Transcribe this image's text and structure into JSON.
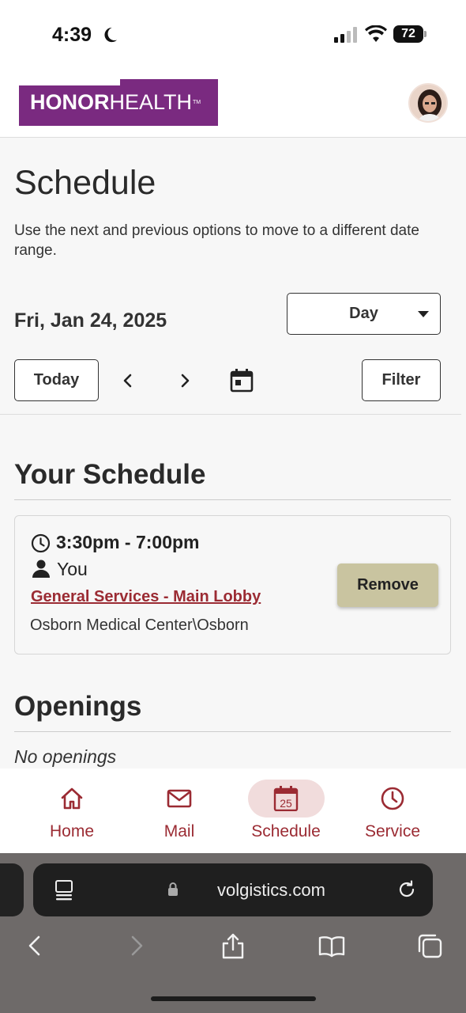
{
  "status_bar": {
    "time": "4:39",
    "battery": "72"
  },
  "header": {
    "logo_bold": "HONOR",
    "logo_light": "HEALTH",
    "logo_tm": "TM"
  },
  "page": {
    "title": "Schedule",
    "subtitle": "Use the next and previous options to move to a different date range.",
    "date_label": "Fri, Jan 24, 2025",
    "view_select": "Day",
    "today_label": "Today",
    "filter_label": "Filter"
  },
  "your_schedule": {
    "title": "Your Schedule",
    "shift": {
      "time": "3:30pm - 7:00pm",
      "who": "You",
      "assignment": "General Services - Main Lobby",
      "location": "Osborn Medical Center\\Osborn",
      "remove_label": "Remove"
    }
  },
  "openings": {
    "title": "Openings",
    "empty_text": "No openings"
  },
  "app_nav": {
    "items": [
      {
        "label": "Home",
        "icon": "home-icon"
      },
      {
        "label": "Mail",
        "icon": "mail-icon"
      },
      {
        "label": "Schedule",
        "icon": "calendar-icon",
        "day": "25",
        "active": true
      },
      {
        "label": "Service",
        "icon": "clock-icon"
      }
    ]
  },
  "browser": {
    "url": "volgistics.com"
  },
  "colors": {
    "brand_purple": "#7a2a80",
    "accent_red": "#9b2b33",
    "remove_button": "#c9c4a0",
    "active_pill": "#f1dcdc"
  }
}
